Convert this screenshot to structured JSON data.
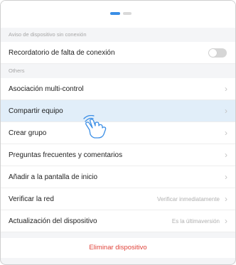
{
  "pager": {
    "pages": 2,
    "active_page": 1
  },
  "offline_section": {
    "header": "Aviso de dispositivo sin conexión",
    "reminder_label": "Recordatorio de falta de conexión",
    "reminder_enabled": false
  },
  "others_section": {
    "header": "Others",
    "items": [
      {
        "label": "Asociación multi-control",
        "value": ""
      },
      {
        "label": "Compartir equipo",
        "value": ""
      },
      {
        "label": "Crear grupo",
        "value": ""
      },
      {
        "label": "Preguntas frecuentes y comentarios",
        "value": ""
      },
      {
        "label": "Añadir a la pantalla de inicio",
        "value": ""
      },
      {
        "label": "Verificar la red",
        "value": "Verificar inmediatamente"
      },
      {
        "label": "Actualización del dispositivo",
        "value": "Es la últimaversión"
      }
    ]
  },
  "delete_label": "Eliminar dispositivo",
  "colors": {
    "accent": "#3a8ee6",
    "danger": "#e0433a",
    "highlight": "#e1eef9"
  },
  "icons": {
    "chevron": "chevron-right-icon",
    "cursor": "hand-pointer-icon"
  }
}
